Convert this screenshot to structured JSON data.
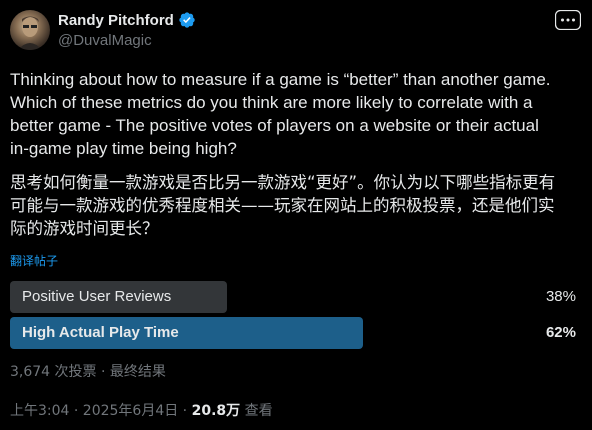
{
  "author": {
    "display_name": "Randy Pitchford",
    "handle": "@DuvalMagic",
    "verified": true
  },
  "tweet": {
    "text_en": "Thinking about how to measure if a game is “better” than another game.\nWhich of these metrics do you think are more likely to correlate with a\nbetter game - The positive votes of players on a website or their actual\nin-game play time being high?",
    "text_zh": "思考如何衡量一款游戏是否比另一款游戏“更好”。你认为以下哪些指标更有\n可能与一款游戏的优秀程度相关——玩家在网站上的积极投票，还是他们实\n际的游戏时间更长？",
    "translate_label": "翻译帖子"
  },
  "poll": {
    "options": [
      {
        "label": "Positive User Reviews",
        "percent_text": "38%",
        "fraction": 0.38,
        "winner": false
      },
      {
        "label": "High Actual Play Time",
        "percent_text": "62%",
        "fraction": 0.62,
        "winner": true
      }
    ],
    "meta": "3,674 次投票 · 最终结果"
  },
  "footer": {
    "time_date": "上午3:04 · 2025年6月4日 · ",
    "views_count": "20.8万",
    "views_label": " 查看"
  },
  "colors": {
    "background": "#000000",
    "text": "#e7e9ea",
    "muted": "#71767b",
    "accent": "#1d9bf0",
    "poll_bar": "#333639",
    "poll_bar_winner": "#1d5f8a"
  },
  "icons": {
    "verified": "verified-badge-icon",
    "more": "more-options-icon"
  }
}
